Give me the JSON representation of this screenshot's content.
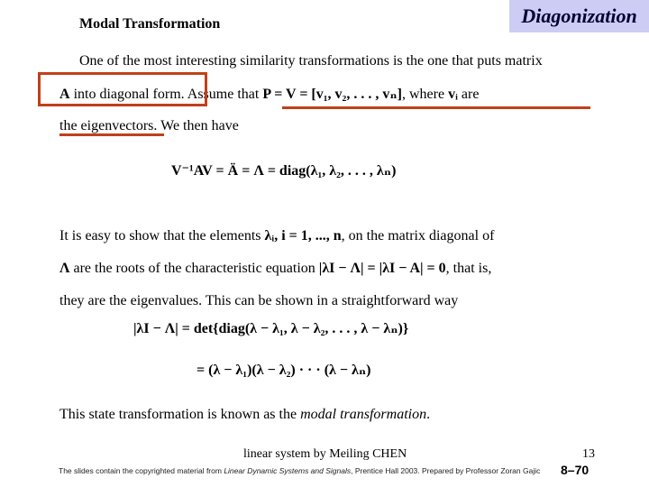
{
  "header": {
    "badge": "Diagonization",
    "section_title": "Modal Transformation"
  },
  "colors": {
    "badge_bg": "#ccccf5",
    "highlight": "#c0401a"
  },
  "paragraph1": {
    "line1": "One of the most interesting similarity transformations is the one that puts matrix",
    "line2_a": "A",
    "line2_b": " into diagonal form.",
    "line2_c": "  Assume that ",
    "line2_eq": "P = V = [v₁, v₂, . . . , vₙ]",
    "line2_d": ", where ",
    "line2_vi": "vᵢ",
    "line2_e": " are",
    "line3_a": "the eigenvectors.",
    "line3_b": "  We then have"
  },
  "equation1": "V⁻¹AV = Ä = Λ = diag(λ₁, λ₂, . . . , λₙ)",
  "paragraph2": {
    "line1_a": "It is easy to show that the elements ",
    "line1_eq": "λᵢ,  i = 1, ..., n",
    "line1_b": ", on the matrix diagonal of",
    "line2_a": "Λ",
    "line2_b": " are the roots of the characteristic equation ",
    "line2_eq": "|λI − Λ| = |λI − A| = 0",
    "line2_c": ", that is,",
    "line3": "they are the eigenvalues.  This can be shown in a straightforward way"
  },
  "equation2": {
    "line1": "|λI − Λ| = det{diag(λ − λ₁, λ − λ₂, . . . , λ − λₙ)}",
    "line2": "= (λ − λ₁)(λ − λ₂) · · · (λ − λₙ)"
  },
  "paragraph3": {
    "text": "This state transformation is known as the ",
    "italic": "modal transformation",
    "end": "."
  },
  "footer": {
    "author": "linear system by Meiling CHEN",
    "page_number": "13",
    "copyright_a": "The slides contain the copyrighted material from ",
    "copyright_book": "Linear Dynamic Systems and Signals",
    "copyright_b": ", Prentice Hall 2003.  Prepared by Professor Zoran Gajic",
    "slide_number": "8–70"
  }
}
